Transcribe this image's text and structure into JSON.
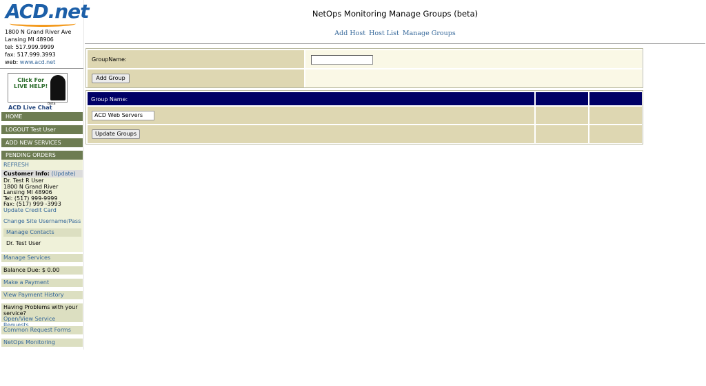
{
  "logo": {
    "text": "ACD.net"
  },
  "address": {
    "street": "1800 N Grand River Ave",
    "city": "Lansing MI 48906",
    "tel": "tel: 517.999.9999",
    "fax": "fax: 517.999.3993",
    "web_prefix": "web: ",
    "web_link": "www.acd.net"
  },
  "live_help": {
    "line1": "Click For",
    "line2": "LIVE HELP!",
    "label": "ACD Live Chat",
    "beta": "Beta"
  },
  "sidebar": {
    "home": "HOME",
    "logout": "LOGOUT Test User",
    "add_services": "ADD NEW SERVICES",
    "pending_orders": "PENDING ORDERS",
    "refresh": "REFRESH",
    "customer_info_label": "Customer Info:",
    "customer_info_update": "(Update)",
    "customer": {
      "name": "Dr. Test R User",
      "street": "1800 N Grand River",
      "city": "Lansing MI 48906",
      "tel": "Tel: (517) 999-9999",
      "fax": "Fax: (517) 999 -3993"
    },
    "update_credit_card": "Update Credit Card",
    "change_username": "Change Site Username/Pass",
    "manage_contacts": "Manage Contacts",
    "contact_name": "Dr. Test User",
    "manage_services": "Manage Services",
    "balance_due": "Balance Due: $ 0.00",
    "make_payment": "Make a Payment",
    "payment_history": "View Payment History",
    "problems_text": "Having Problems with your service?",
    "service_requests": "Open/View Service Requests",
    "request_forms": "Common Request Forms",
    "netops": "NetOps Monitoring"
  },
  "header": {
    "title": "NetOps Monitoring Manage Groups (beta)",
    "nav": [
      "Add Host",
      "Host List",
      "Manage Groups"
    ]
  },
  "add_form": {
    "label": "GroupName:",
    "input_value": "",
    "button": "Add Group"
  },
  "groups_table": {
    "header": "Group Name:",
    "rows": [
      {
        "name": "ACD Web Servers"
      }
    ],
    "update_button": "Update Groups"
  },
  "colors": {
    "navy_header": "#000066",
    "tan": "#ded7b2",
    "cream": "#faf8e6",
    "sidebar_dark": "#6d7c52",
    "sidebar_light": "#dcdfc1",
    "link": "#336699"
  }
}
